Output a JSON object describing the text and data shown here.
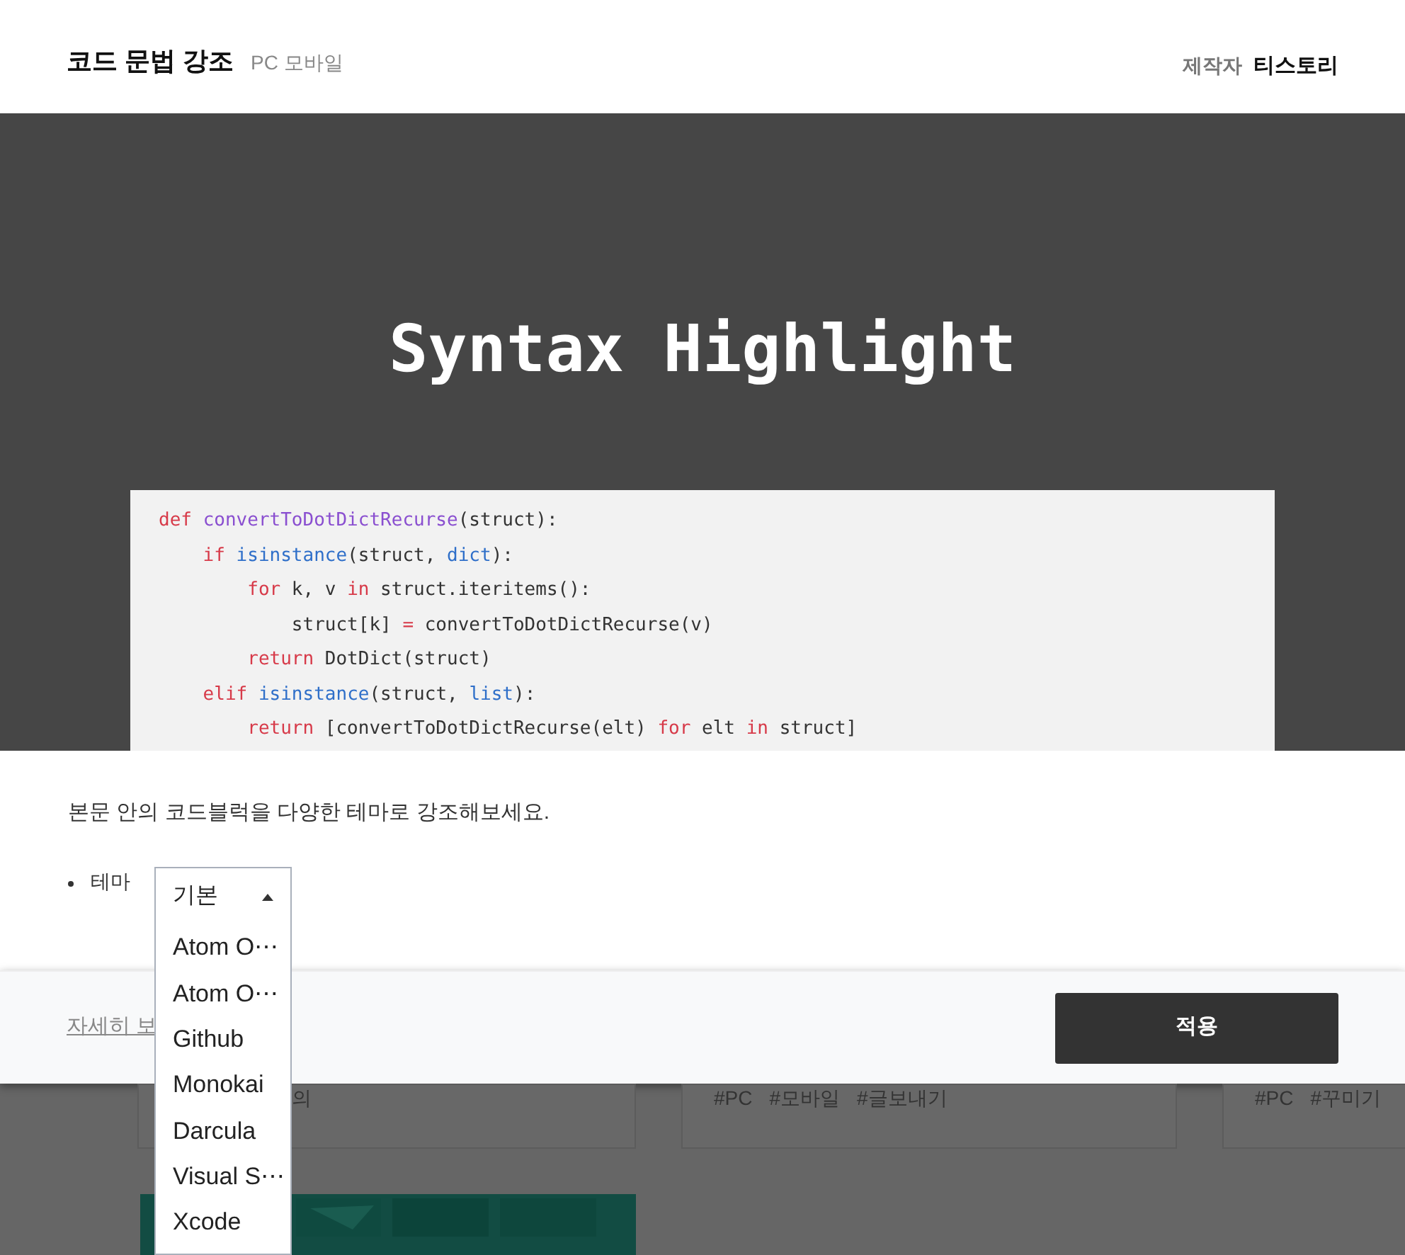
{
  "header": {
    "title": "코드 문법 강조",
    "platforms": "PC 모바일",
    "author_label": "제작자",
    "author": "티스토리"
  },
  "hero": {
    "title": "Syntax Highlight",
    "code_lines": [
      [
        {
          "text": "def ",
          "kind": "keyword"
        },
        {
          "text": "convertToDotDictRecurse",
          "kind": "function"
        },
        {
          "text": "(struct):",
          "kind": "plain"
        }
      ],
      [
        {
          "text": "    if ",
          "kind": "keyword"
        },
        {
          "text": "isinstance",
          "kind": "builtin"
        },
        {
          "text": "(struct, ",
          "kind": "plain"
        },
        {
          "text": "dict",
          "kind": "builtin"
        },
        {
          "text": "):",
          "kind": "plain"
        }
      ],
      [
        {
          "text": "        for ",
          "kind": "keyword"
        },
        {
          "text": "k, v ",
          "kind": "plain"
        },
        {
          "text": "in ",
          "kind": "keyword"
        },
        {
          "text": "struct.iteritems():",
          "kind": "plain"
        }
      ],
      [
        {
          "text": "            struct[k] ",
          "kind": "plain"
        },
        {
          "text": "= ",
          "kind": "keyword"
        },
        {
          "text": "convertToDotDictRecurse(v)",
          "kind": "plain"
        }
      ],
      [
        {
          "text": "        return ",
          "kind": "keyword"
        },
        {
          "text": "DotDict(struct)",
          "kind": "plain"
        }
      ],
      [
        {
          "text": "    elif ",
          "kind": "keyword"
        },
        {
          "text": "isinstance",
          "kind": "builtin"
        },
        {
          "text": "(struct, ",
          "kind": "plain"
        },
        {
          "text": "list",
          "kind": "builtin"
        },
        {
          "text": "):",
          "kind": "plain"
        }
      ],
      [
        {
          "text": "        return ",
          "kind": "keyword"
        },
        {
          "text": "[convertToDotDictRecurse(elt) ",
          "kind": "plain"
        },
        {
          "text": "for ",
          "kind": "keyword"
        },
        {
          "text": "elt ",
          "kind": "plain"
        },
        {
          "text": "in ",
          "kind": "keyword"
        },
        {
          "text": "struct]",
          "kind": "plain"
        }
      ]
    ]
  },
  "panel": {
    "description": "본문 안의 코드블럭을 다양한 테마로 강조해보세요.",
    "option_label": "테마",
    "select": {
      "value": "기본",
      "expanded": true,
      "options": [
        {
          "label": "Atom O⋯",
          "selected": false
        },
        {
          "label": "Atom O⋯",
          "selected": false
        },
        {
          "label": "Github",
          "selected": false
        },
        {
          "label": "Monokai",
          "selected": false
        },
        {
          "label": "Darcula",
          "selected": false
        },
        {
          "label": "Visual S⋯",
          "selected": false
        },
        {
          "label": "Xcode",
          "selected": false
        }
      ]
    }
  },
  "footer": {
    "details_link": "자세히 보",
    "apply_button": "적용"
  },
  "background_cards": [
    {
      "tags": [
        "의"
      ]
    },
    {
      "tags": [
        "#PC",
        "#모바일",
        "#글보내기"
      ]
    },
    {
      "tags": [
        "#PC",
        "#꾸미기"
      ]
    }
  ]
}
